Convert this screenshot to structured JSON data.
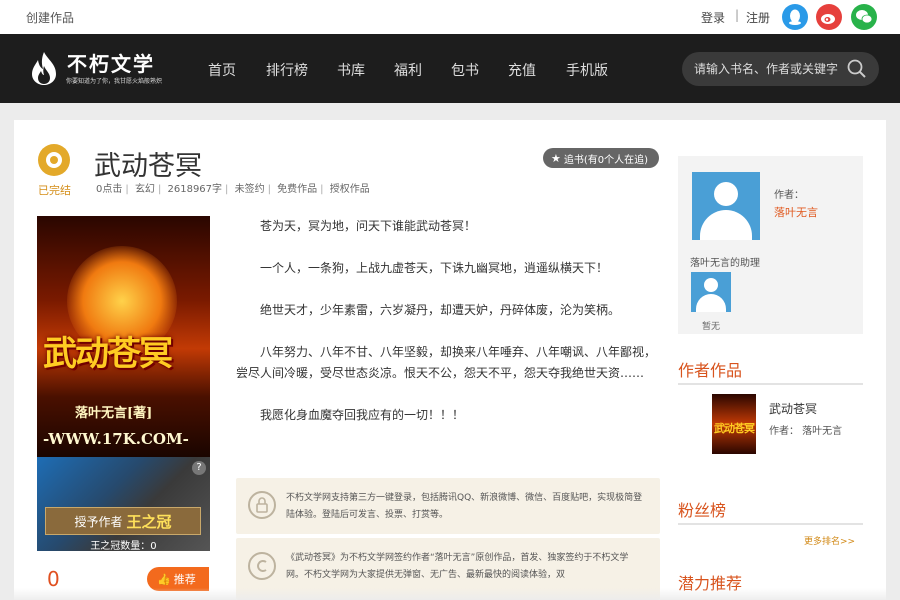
{
  "topbar": {
    "create": "创建作品",
    "login": "登录",
    "separator": "|",
    "register": "注册"
  },
  "brand": {
    "name": "不朽文学",
    "slogan": "你要知道为了你，我甘愿火焰般熟炽"
  },
  "nav": {
    "items": [
      "首页",
      "排行榜",
      "书库",
      "福利",
      "包书",
      "充值",
      "手机版"
    ]
  },
  "search": {
    "placeholder": "请输入书名、作者或关键字"
  },
  "book": {
    "status": "已完结",
    "title": "武动苍冥",
    "meta": [
      "0点击",
      "玄幻",
      "2618967字",
      "未签约",
      "免费作品",
      "授权作品"
    ],
    "favorite_button": "追书(有0个人在追)",
    "cover": {
      "title": "武动苍冥",
      "author": "落叶无言[著]",
      "url": "-WWW.17K.COM-"
    },
    "award": {
      "question": "?",
      "label": "授予作者",
      "crown": "王之冠",
      "count": "王之冠数量：0"
    },
    "votes": "0",
    "recommend_button": "推荐",
    "intro": [
      "苍为天，冥为地，问天下谁能武动苍冥！",
      "一个人，一条狗，上战九虚苍天，下诛九幽冥地，逍遥纵横天下！",
      "绝世天才，少年素雷，六岁凝丹，却遭天妒，丹碎体废，沦为笑柄。",
      "八年努力、八年不甘、八年坚毅，却换来八年唾弃、八年嘲讽、八年鄙视，尝尽人间冷暖，受尽世态炎凉。恨天不公，怨天不平，怨天夺我绝世天资……",
      "我愿化身血魔夺回我应有的一切！！！"
    ],
    "notice_login": "不朽文学网支持第三方一键登录，包括腾讯QQ、新浪微博、微信、百度贴吧，实现极简登陆体验。登陆后可发言、投票、打赏等。",
    "notice_copyright": "《武动苍冥》为不朽文学网签约作者“落叶无言”原创作品，首发、独家签约于不朽文学网。不朽文学网为大家提供无弹窗、无广告、最新最快的阅读体验，双"
  },
  "sidebar": {
    "author_label": "作者：",
    "author_name": "落叶无言",
    "assistant_label": "落叶无言的助理",
    "assistant_none": "暂无",
    "works_title": "作者作品",
    "work": {
      "thumb_text": "武动苍冥",
      "title": "武动苍冥",
      "author": "作者： 落叶无言"
    },
    "fans_title": "粉丝榜",
    "more_rank": "更多排名>>",
    "potential_title": "潜力推荐"
  },
  "colors": {
    "navbar": "#1d1d1d",
    "accent": "#d8541e",
    "status": "#e3a92a",
    "qq": "#2a9ae8",
    "weibo": "#e6403c",
    "wechat": "#28b24a"
  }
}
